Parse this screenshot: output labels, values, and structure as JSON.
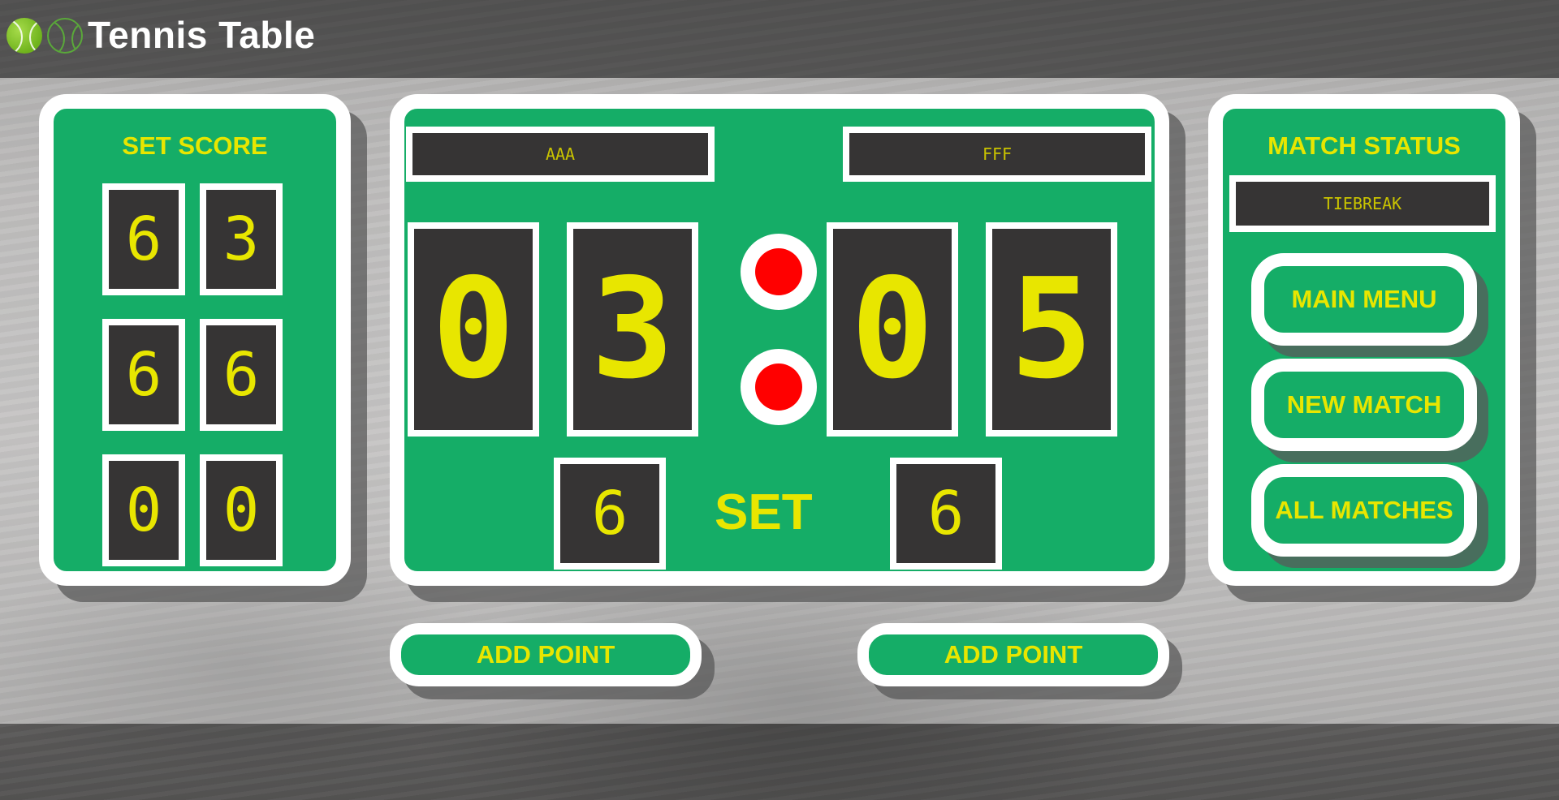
{
  "app": {
    "title": "Tennis Table"
  },
  "set_score": {
    "title": "SET SCORE",
    "rows": [
      {
        "left": "6",
        "right": "3"
      },
      {
        "left": "6",
        "right": "6"
      },
      {
        "left": "0",
        "right": "0"
      }
    ]
  },
  "scoreboard": {
    "player1": {
      "name": "AAA",
      "points_tens": "0",
      "points_ones": "3",
      "games": "6"
    },
    "player2": {
      "name": "FFF",
      "points_tens": "0",
      "points_ones": "5",
      "games": "6"
    },
    "set_label": "SET"
  },
  "match_status": {
    "title": "MATCH STATUS",
    "status": "TIEBREAK",
    "buttons": {
      "main_menu": "MAIN MENU",
      "new_match": "NEW MATCH",
      "all_matches": "ALL MATCHES"
    }
  },
  "controls": {
    "add_point_p1": "ADD POINT",
    "add_point_p2": "ADD POINT"
  },
  "colors": {
    "panel_green": "#15ad67",
    "display_dark": "#363434",
    "digit_yellow": "#e8e600",
    "serve_red": "#ff0000"
  }
}
